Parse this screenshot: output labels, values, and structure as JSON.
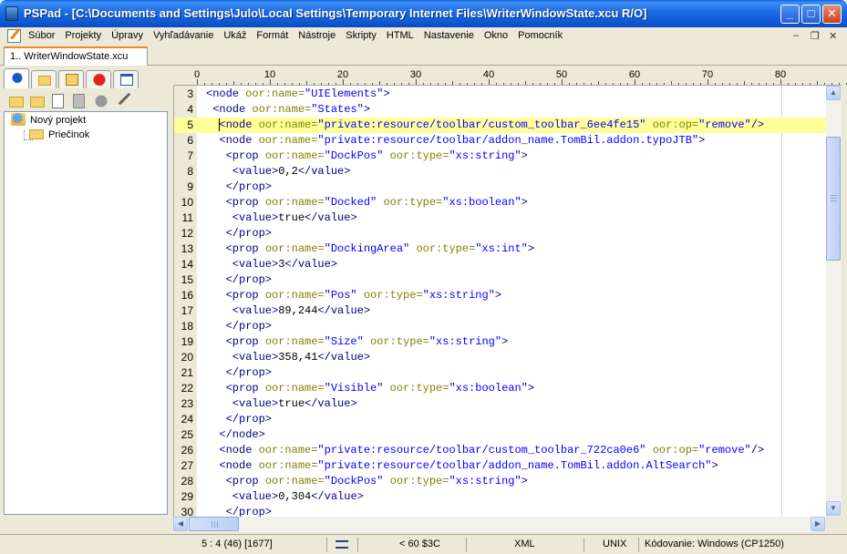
{
  "window": {
    "title": "PSPad - [C:\\Documents and Settings\\Julo\\Local Settings\\Temporary Internet Files\\WriterWindowState.xcu R/O]",
    "controls": {
      "minimize": "_",
      "maximize": "□",
      "close": "✕"
    }
  },
  "menu": {
    "items": [
      "Súbor",
      "Projekty",
      "Úpravy",
      "Vyhľadávanie",
      "Ukáž",
      "Formát",
      "Nástroje",
      "Skripty",
      "HTML",
      "Nastavenie",
      "Okno",
      "Pomocník"
    ],
    "mdi_controls": {
      "minimize": "–",
      "restore": "❐",
      "close": "✕"
    }
  },
  "document_tab": {
    "label": "1.. WriterWindowState.xcu"
  },
  "left_panel": {
    "tab_icons": [
      "project-icon",
      "folder-icon",
      "ftp-icon",
      "favorites-icon",
      "window-list-icon"
    ],
    "toolbar_icons": [
      "new-project-icon",
      "delete-icon",
      "add-file-icon",
      "remove-icon",
      "record-icon",
      "tools-icon"
    ],
    "tree": [
      {
        "label": "Nový projekt",
        "icon": "project-icon"
      },
      {
        "label": "Priečinok",
        "icon": "folder-icon"
      }
    ]
  },
  "ruler": {
    "labels": [
      "0",
      "10",
      "20",
      "30",
      "40",
      "50",
      "60",
      "70",
      "80"
    ]
  },
  "editor": {
    "current_line": 5,
    "colors": {
      "tag": "#000080",
      "attribute": "#808000",
      "value": "#0000ff",
      "current_line_bg": "#ffff99"
    },
    "lines": [
      {
        "n": "3",
        "tokens": [
          [
            "tg",
            "<node "
          ],
          [
            "at",
            "oor:name="
          ],
          [
            "vl",
            "\"UIElements\""
          ],
          [
            "tg",
            ">"
          ]
        ]
      },
      {
        "n": "4",
        "tokens": [
          [
            "tg",
            " <node "
          ],
          [
            "at",
            "oor:name="
          ],
          [
            "vl",
            "\"States\""
          ],
          [
            "tg",
            ">"
          ]
        ]
      },
      {
        "n": "5",
        "tokens": [
          [
            "tg",
            "  <node "
          ],
          [
            "at",
            "oor:name="
          ],
          [
            "vl",
            "\"private:resource/toolbar/custom_toolbar_6ee4fe15\""
          ],
          [
            "tx",
            " "
          ],
          [
            "at",
            "oor:op="
          ],
          [
            "vl",
            "\"remove\""
          ],
          [
            "tg",
            "/>"
          ]
        ]
      },
      {
        "n": "6",
        "tokens": [
          [
            "tg",
            "  <node "
          ],
          [
            "at",
            "oor:name="
          ],
          [
            "vl",
            "\"private:resource/toolbar/addon_name.TomBil.addon.typoJTB\""
          ],
          [
            "tg",
            ">"
          ]
        ]
      },
      {
        "n": "7",
        "tokens": [
          [
            "tg",
            "   <prop "
          ],
          [
            "at",
            "oor:name="
          ],
          [
            "vl",
            "\"DockPos\""
          ],
          [
            "tx",
            " "
          ],
          [
            "at",
            "oor:type="
          ],
          [
            "vl",
            "\"xs:string\""
          ],
          [
            "tg",
            ">"
          ]
        ]
      },
      {
        "n": "8",
        "tokens": [
          [
            "tg",
            "    <value>"
          ],
          [
            "tx",
            "0,2"
          ],
          [
            "tg",
            "</value>"
          ]
        ]
      },
      {
        "n": "9",
        "tokens": [
          [
            "tg",
            "   </prop>"
          ]
        ]
      },
      {
        "n": "10",
        "tokens": [
          [
            "tg",
            "   <prop "
          ],
          [
            "at",
            "oor:name="
          ],
          [
            "vl",
            "\"Docked\""
          ],
          [
            "tx",
            " "
          ],
          [
            "at",
            "oor:type="
          ],
          [
            "vl",
            "\"xs:boolean\""
          ],
          [
            "tg",
            ">"
          ]
        ]
      },
      {
        "n": "11",
        "tokens": [
          [
            "tg",
            "    <value>"
          ],
          [
            "tx",
            "true"
          ],
          [
            "tg",
            "</value>"
          ]
        ]
      },
      {
        "n": "12",
        "tokens": [
          [
            "tg",
            "   </prop>"
          ]
        ]
      },
      {
        "n": "13",
        "tokens": [
          [
            "tg",
            "   <prop "
          ],
          [
            "at",
            "oor:name="
          ],
          [
            "vl",
            "\"DockingArea\""
          ],
          [
            "tx",
            " "
          ],
          [
            "at",
            "oor:type="
          ],
          [
            "vl",
            "\"xs:int\""
          ],
          [
            "tg",
            ">"
          ]
        ]
      },
      {
        "n": "14",
        "tokens": [
          [
            "tg",
            "    <value>"
          ],
          [
            "tx",
            "3"
          ],
          [
            "tg",
            "</value>"
          ]
        ]
      },
      {
        "n": "15",
        "tokens": [
          [
            "tg",
            "   </prop>"
          ]
        ]
      },
      {
        "n": "16",
        "tokens": [
          [
            "tg",
            "   <prop "
          ],
          [
            "at",
            "oor:name="
          ],
          [
            "vl",
            "\"Pos\""
          ],
          [
            "tx",
            " "
          ],
          [
            "at",
            "oor:type="
          ],
          [
            "vl",
            "\"xs:string\""
          ],
          [
            "tg",
            ">"
          ]
        ]
      },
      {
        "n": "17",
        "tokens": [
          [
            "tg",
            "    <value>"
          ],
          [
            "tx",
            "89,244"
          ],
          [
            "tg",
            "</value>"
          ]
        ]
      },
      {
        "n": "18",
        "tokens": [
          [
            "tg",
            "   </prop>"
          ]
        ]
      },
      {
        "n": "19",
        "tokens": [
          [
            "tg",
            "   <prop "
          ],
          [
            "at",
            "oor:name="
          ],
          [
            "vl",
            "\"Size\""
          ],
          [
            "tx",
            " "
          ],
          [
            "at",
            "oor:type="
          ],
          [
            "vl",
            "\"xs:string\""
          ],
          [
            "tg",
            ">"
          ]
        ]
      },
      {
        "n": "20",
        "tokens": [
          [
            "tg",
            "    <value>"
          ],
          [
            "tx",
            "358,41"
          ],
          [
            "tg",
            "</value>"
          ]
        ]
      },
      {
        "n": "21",
        "tokens": [
          [
            "tg",
            "   </prop>"
          ]
        ]
      },
      {
        "n": "22",
        "tokens": [
          [
            "tg",
            "   <prop "
          ],
          [
            "at",
            "oor:name="
          ],
          [
            "vl",
            "\"Visible\""
          ],
          [
            "tx",
            " "
          ],
          [
            "at",
            "oor:type="
          ],
          [
            "vl",
            "\"xs:boolean\""
          ],
          [
            "tg",
            ">"
          ]
        ]
      },
      {
        "n": "23",
        "tokens": [
          [
            "tg",
            "    <value>"
          ],
          [
            "tx",
            "true"
          ],
          [
            "tg",
            "</value>"
          ]
        ]
      },
      {
        "n": "24",
        "tokens": [
          [
            "tg",
            "   </prop>"
          ]
        ]
      },
      {
        "n": "25",
        "tokens": [
          [
            "tg",
            "  </node>"
          ]
        ]
      },
      {
        "n": "26",
        "tokens": [
          [
            "tg",
            "  <node "
          ],
          [
            "at",
            "oor:name="
          ],
          [
            "vl",
            "\"private:resource/toolbar/custom_toolbar_722ca0e6\""
          ],
          [
            "tx",
            " "
          ],
          [
            "at",
            "oor:op="
          ],
          [
            "vl",
            "\"remove\""
          ],
          [
            "tg",
            "/>"
          ]
        ]
      },
      {
        "n": "27",
        "tokens": [
          [
            "tg",
            "  <node "
          ],
          [
            "at",
            "oor:name="
          ],
          [
            "vl",
            "\"private:resource/toolbar/addon_name.TomBil.addon.AltSearch\""
          ],
          [
            "tg",
            ">"
          ]
        ]
      },
      {
        "n": "28",
        "tokens": [
          [
            "tg",
            "   <prop "
          ],
          [
            "at",
            "oor:name="
          ],
          [
            "vl",
            "\"DockPos\""
          ],
          [
            "tx",
            " "
          ],
          [
            "at",
            "oor:type="
          ],
          [
            "vl",
            "\"xs:string\""
          ],
          [
            "tg",
            ">"
          ]
        ]
      },
      {
        "n": "29",
        "tokens": [
          [
            "tg",
            "    <value>"
          ],
          [
            "tx",
            "0,304"
          ],
          [
            "tg",
            "</value>"
          ]
        ]
      },
      {
        "n": "30",
        "tokens": [
          [
            "tg",
            "   </prop>"
          ]
        ]
      }
    ]
  },
  "status": {
    "position": "5 : 4  (46)  [1677]",
    "char": "<  60 $3C",
    "syntax": "XML",
    "line_end": "UNIX",
    "encoding": "Kódovanie: Windows (CP1250)"
  }
}
